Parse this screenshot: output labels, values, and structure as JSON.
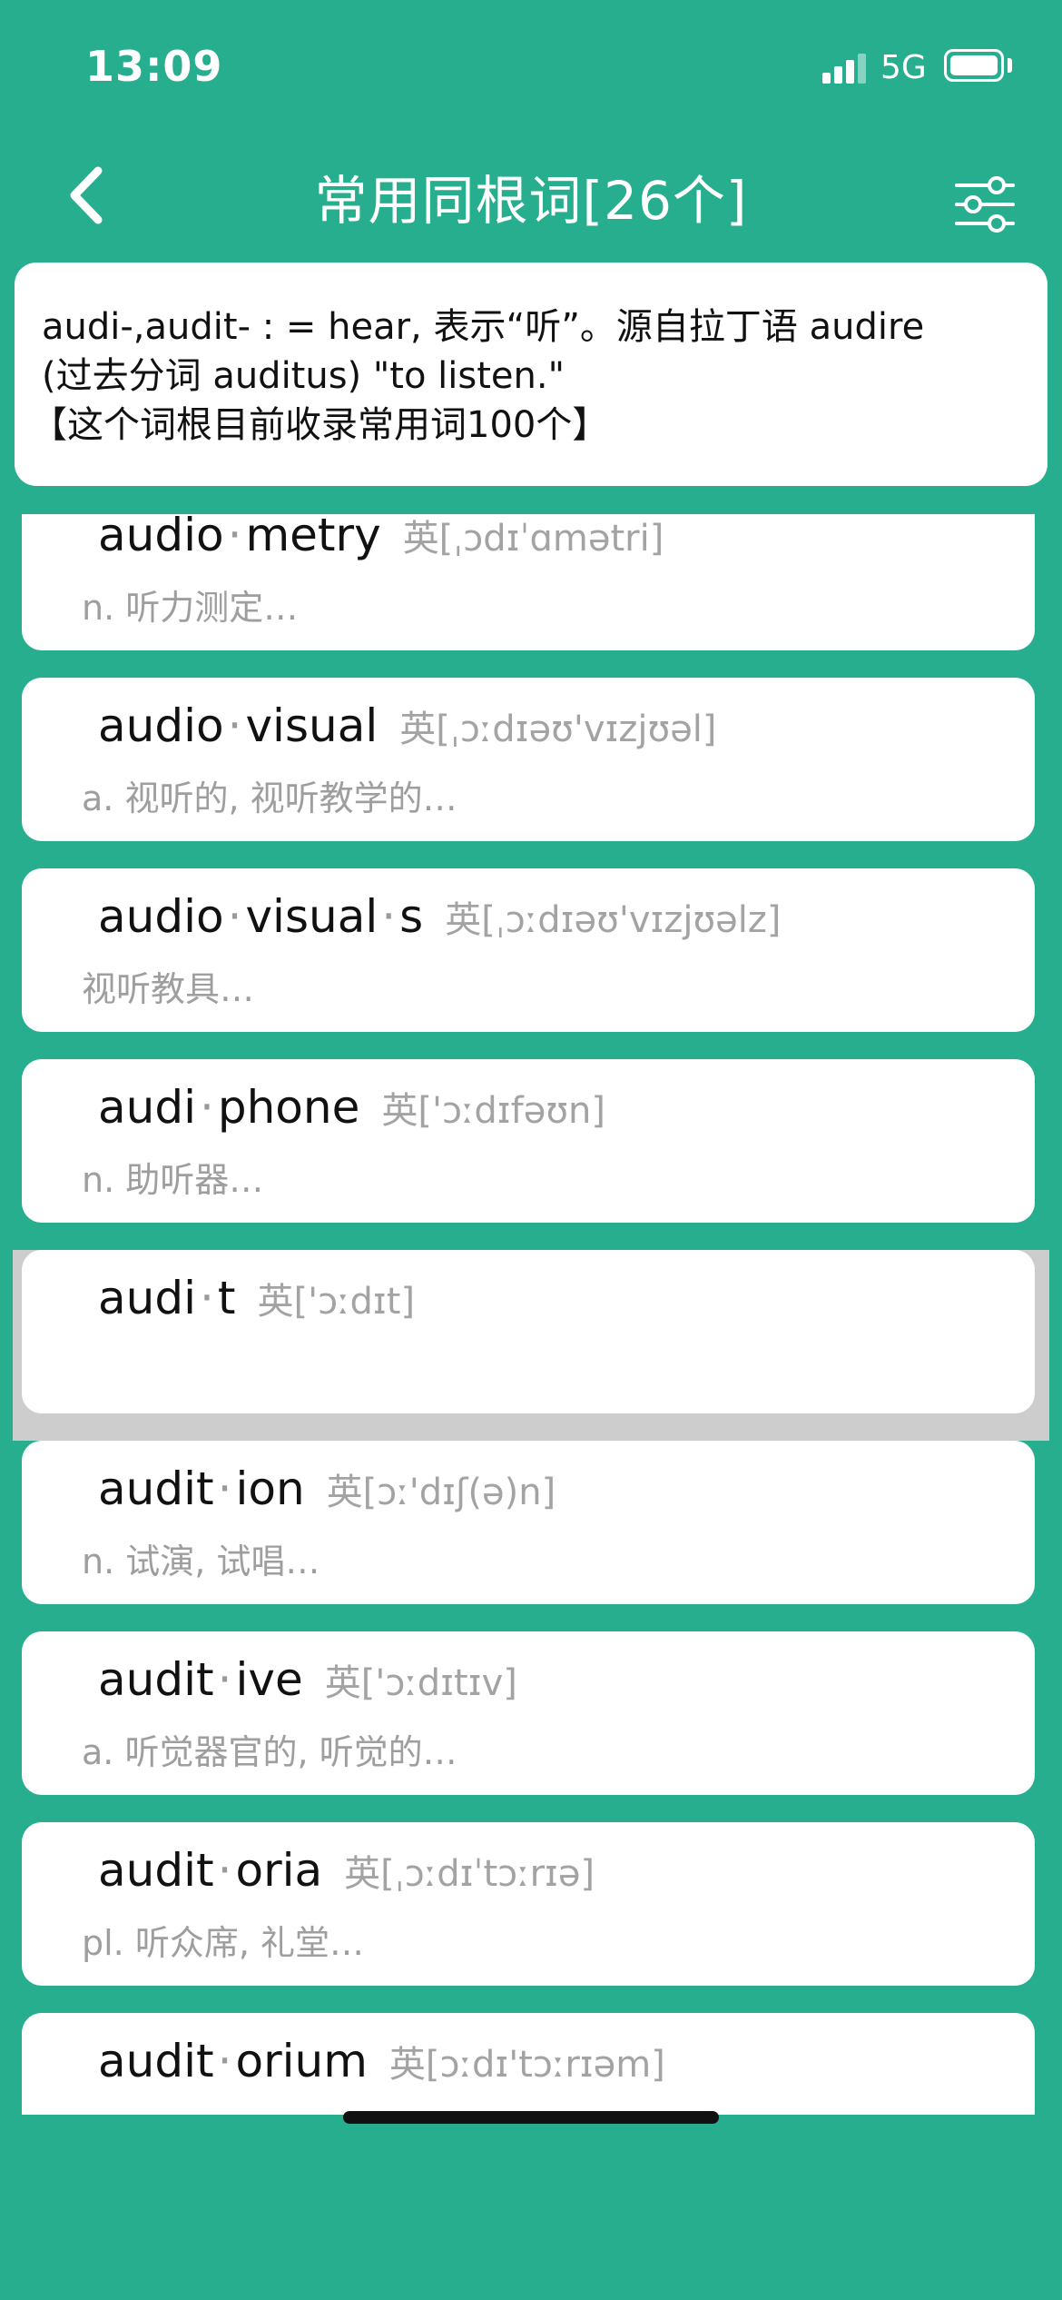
{
  "status": {
    "time": "13:09",
    "network": "5G"
  },
  "nav": {
    "title": "常用同根词[26个]"
  },
  "intro": {
    "line1": "audi-,audit- : = hear, 表示“听”。源自拉丁语 audire",
    "line2": "(过去分词 auditus) \"to listen.\"",
    "line3": "【这个词根目前收录常用词100个】"
  },
  "words": [
    {
      "root": "audio",
      "suffix": "metry",
      "phonetic": "英[ˌɔdɪˈɑmətri]",
      "meaning": "n. 听力测定…"
    },
    {
      "root": "audio",
      "suffix": "visual",
      "phonetic": "英[ˌɔːdɪəʊ'vɪzjʊəl]",
      "meaning": "a. 视听的, 视听教学的…"
    },
    {
      "root": "audio",
      "suffix": "visual",
      "suffix2": "s",
      "phonetic": "英[ˌɔːdɪəʊ'vɪzjʊəlz]",
      "meaning": "视听教具…"
    },
    {
      "root": "audi",
      "suffix": "phone",
      "phonetic": "英['ɔːdɪfəʊn]",
      "meaning": "n. 助听器…"
    },
    {
      "root": "audi",
      "suffix": "t",
      "phonetic": "英['ɔːdɪt]",
      "meaning": ""
    },
    {
      "root": "audit",
      "suffix": "ion",
      "phonetic": "英[ɔː'dɪʃ(ə)n]",
      "meaning": "n. 试演, 试唱…"
    },
    {
      "root": "audit",
      "suffix": "ive",
      "phonetic": "英['ɔːdɪtɪv]",
      "meaning": "a. 听觉器官的, 听觉的…"
    },
    {
      "root": "audit",
      "suffix": "oria",
      "phonetic": "英[ˌɔːdɪˈtɔːrɪə]",
      "meaning": "pl. 听众席, 礼堂…"
    },
    {
      "root": "audit",
      "suffix": "orium",
      "phonetic": "英[ɔːdɪ'tɔːrɪəm]",
      "meaning": ""
    }
  ],
  "colors": {
    "background": "#27AE8E",
    "card": "#FFFFFF",
    "selected_row": "#CDCDCD"
  }
}
